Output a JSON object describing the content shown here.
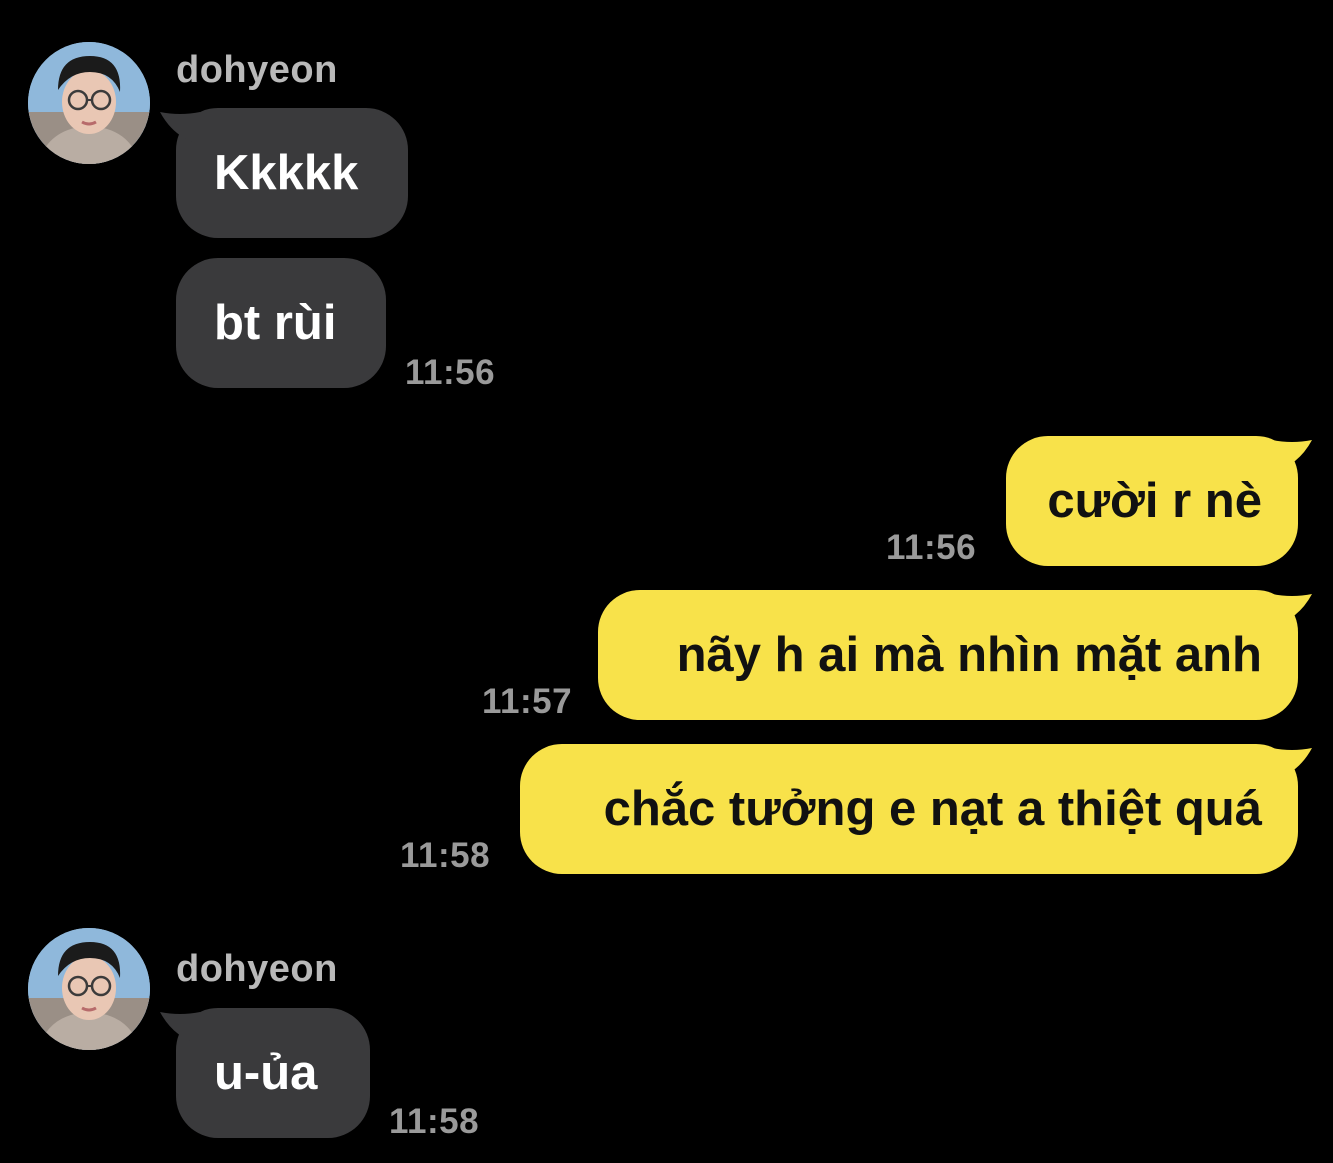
{
  "messages": [
    {
      "sender": "dohyeon",
      "text": "Kkkkk"
    },
    {
      "sender": "dohyeon",
      "text": "bt rùi",
      "time": "11:56"
    },
    {
      "sender": "me",
      "text": "cười r nè",
      "time": "11:56"
    },
    {
      "sender": "me",
      "text": "nãy h ai mà nhìn mặt anh",
      "time": "11:57"
    },
    {
      "sender": "me",
      "text": "chắc tưởng e nạt a thiệt quá",
      "time": "11:58"
    },
    {
      "sender": "dohyeon",
      "text": "u-ủa",
      "time": "11:58"
    }
  ],
  "groups": [
    {
      "name": "dohyeon",
      "avatar": "profile-photo"
    },
    {
      "name": "dohyeon",
      "avatar": "profile-photo"
    }
  ],
  "colors": {
    "background": "#000000",
    "incoming_bubble": "#3a3a3c",
    "outgoing_bubble": "#f8e24a",
    "sender_name": "#b9b9b9",
    "timestamp": "#9a9a9a"
  }
}
